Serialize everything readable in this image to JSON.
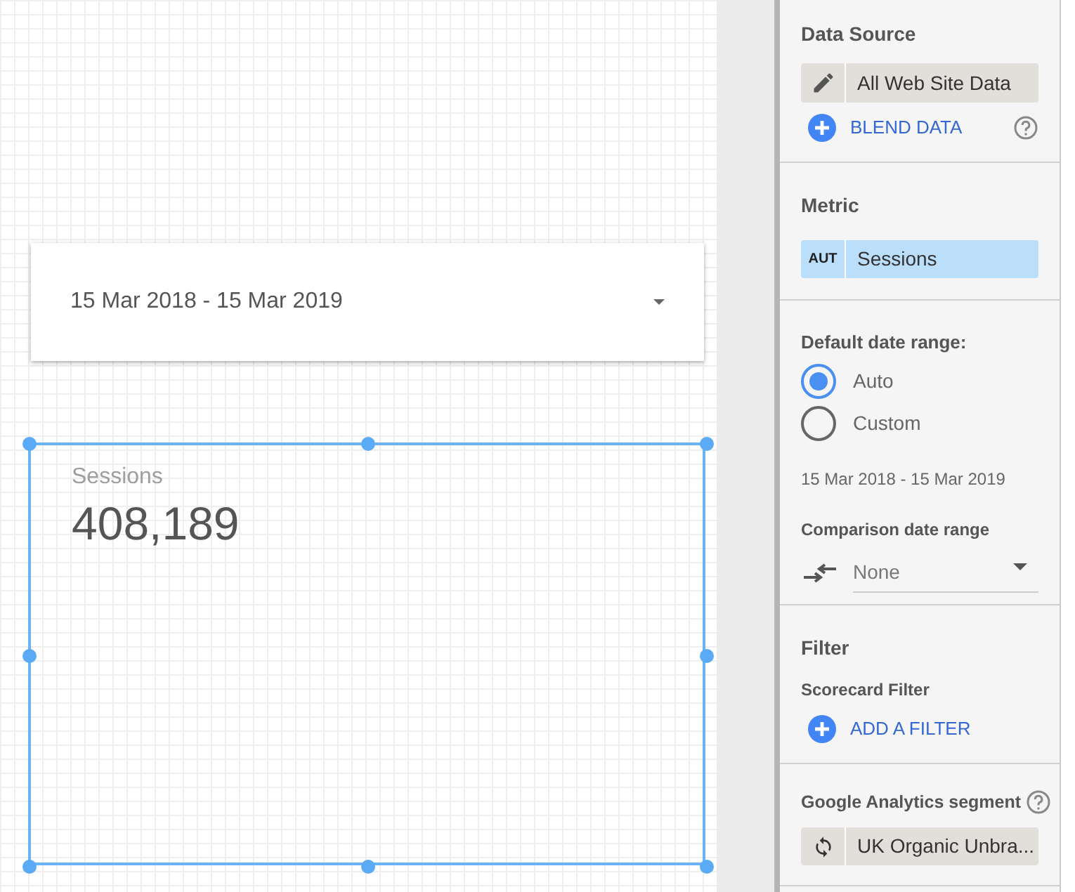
{
  "canvas": {
    "date_control": {
      "text": "15 Mar 2018 - 15 Mar 2019"
    },
    "scorecard": {
      "label": "Sessions",
      "value": "408,189",
      "selected": true
    }
  },
  "panel": {
    "data_source": {
      "heading": "Data Source",
      "source": "All Web Site Data",
      "blend_link": "BLEND DATA"
    },
    "metric": {
      "heading": "Metric",
      "tag": "AUT",
      "name": "Sessions"
    },
    "date_range": {
      "heading": "Default date range:",
      "options": [
        {
          "label": "Auto",
          "selected": true
        },
        {
          "label": "Custom",
          "selected": false
        }
      ],
      "range_text": "15 Mar 2018 - 15 Mar 2019",
      "comparison_heading": "Comparison date range",
      "comparison_value": "None"
    },
    "filter": {
      "heading": "Filter",
      "subheading": "Scorecard Filter",
      "link": "ADD A FILTER"
    },
    "segment": {
      "heading": "Google Analytics segment",
      "value": "UK Organic Unbra..."
    }
  }
}
